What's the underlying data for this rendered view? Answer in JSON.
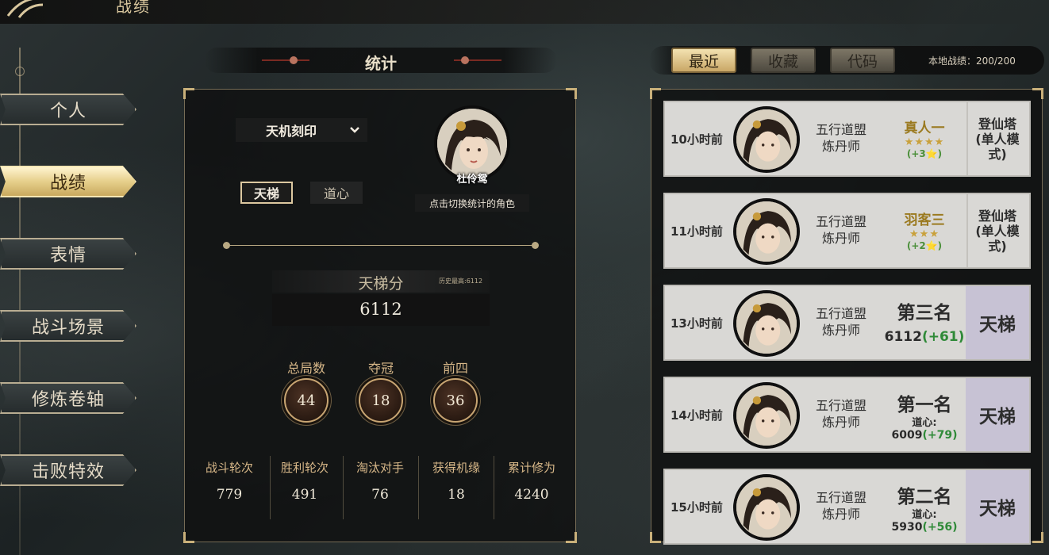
{
  "page": {
    "title": "战绩"
  },
  "nav": {
    "items": [
      {
        "label": "个人",
        "active": false
      },
      {
        "label": "战绩",
        "active": true
      },
      {
        "label": "表情",
        "active": false
      },
      {
        "label": "战斗场景",
        "active": false
      },
      {
        "label": "修炼卷轴",
        "active": false
      },
      {
        "label": "击败特效",
        "active": false
      }
    ]
  },
  "stats": {
    "title": "统计",
    "mode_select": "天机刻印",
    "tabs": [
      "天梯",
      "道心"
    ],
    "character": {
      "name": "杜伶鸳",
      "switch_hint": "点击切换统计的角色"
    },
    "score": {
      "label": "天梯分",
      "best": "历史最高:6112",
      "value": "6112"
    },
    "circles": [
      {
        "label": "总局数",
        "value": "44"
      },
      {
        "label": "夺冠",
        "value": "18"
      },
      {
        "label": "前四",
        "value": "36"
      }
    ],
    "bottom": [
      {
        "label": "战斗轮次",
        "value": "779"
      },
      {
        "label": "胜利轮次",
        "value": "491"
      },
      {
        "label": "淘汰对手",
        "value": "76"
      },
      {
        "label": "获得机缘",
        "value": "18"
      },
      {
        "label": "累计修为",
        "value": "4240"
      }
    ]
  },
  "records": {
    "tabs": [
      "最近",
      "收藏",
      "代码"
    ],
    "active_tab": "最近",
    "local_count": "本地战绩：200/200",
    "items": [
      {
        "time": "10小时前",
        "faction": [
          "五行道盟",
          "炼丹师"
        ],
        "result": "真人一",
        "stars": 4,
        "delta": "(+3⭐)",
        "mode": "登仙塔(单人模式)"
      },
      {
        "time": "11小时前",
        "faction": [
          "五行道盟",
          "炼丹师"
        ],
        "result": "羽客三",
        "stars": 3,
        "delta": "(+2⭐)",
        "mode": "登仙塔(单人模式)"
      },
      {
        "time": "13小时前",
        "faction": [
          "五行道盟",
          "炼丹师"
        ],
        "rank": "第三名",
        "score": "6112",
        "gain": "(+61)",
        "mode": "天梯"
      },
      {
        "time": "14小时前",
        "faction": [
          "五行道盟",
          "炼丹师"
        ],
        "rank": "第一名",
        "dao_label": "道心:",
        "score": "6009",
        "gain": "(+79)",
        "mode": "天梯"
      },
      {
        "time": "15小时前",
        "faction": [
          "五行道盟",
          "炼丹师"
        ],
        "rank": "第二名",
        "dao_label": "道心:",
        "score": "5930",
        "gain": "(+56)",
        "mode": "天梯"
      }
    ]
  },
  "colors": {
    "accent_gold": "#d8b889",
    "gain_green": "#2f8a38",
    "ladder_bg": "#c7c2d4"
  }
}
